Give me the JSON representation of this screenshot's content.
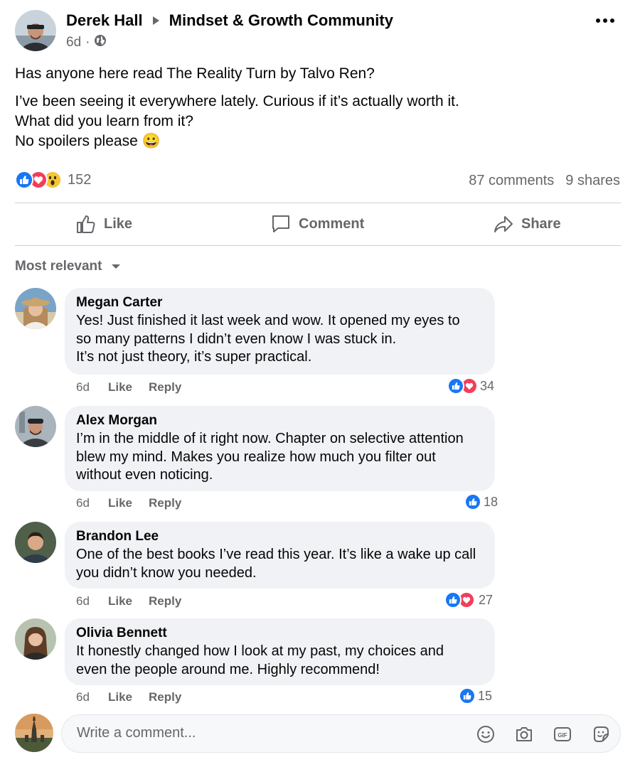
{
  "post": {
    "author": "Derek Hall",
    "group": "Mindset & Growth Community",
    "time": "6d",
    "separator": "·",
    "privacy_icon": "globe-icon",
    "menu_icon": "more-options-icon",
    "text_first": "Has anyone here read The Reality Turn by Talvo Ren?",
    "text_lines": [
      "I’ve been seeing it everywhere lately. Curious if it’s actually worth it.",
      "What did you learn from it?",
      "No spoilers please 😀"
    ],
    "reaction_icons": [
      "like-icon",
      "love-icon",
      "wow-icon"
    ],
    "reaction_count": "152",
    "comments_count": "87 comments",
    "shares_count": "9 shares"
  },
  "actions": {
    "like": "Like",
    "comment": "Comment",
    "share": "Share"
  },
  "sort_label": "Most relevant",
  "comments": [
    {
      "name": "Megan Carter",
      "lines": [
        "Yes! Just finished it last week and wow. It opened my eyes to",
        "so many patterns I didn’t even know I was stuck in.",
        "It’s not just theory, it’s super practical."
      ],
      "time": "6d",
      "like": "Like",
      "reply": "Reply",
      "reactions": [
        "like-icon",
        "love-icon"
      ],
      "count": "34"
    },
    {
      "name": "Alex Morgan",
      "lines": [
        "I’m in the middle of it right now. Chapter on selective attention",
        "blew my mind. Makes you realize how much you filter out",
        "without even noticing."
      ],
      "time": "6d",
      "like": "Like",
      "reply": "Reply",
      "reactions": [
        "like-icon"
      ],
      "count": "18"
    },
    {
      "name": "Brandon Lee",
      "lines": [
        "One of the best books I’ve read this year. It’s like a wake up call",
        "you didn’t know you needed."
      ],
      "time": "6d",
      "like": "Like",
      "reply": "Reply",
      "reactions": [
        "like-icon",
        "love-icon"
      ],
      "count": "27"
    },
    {
      "name": "Olivia Bennett",
      "lines": [
        "It honestly changed how I look at my past, my choices and",
        "even the people around me. Highly recommend!"
      ],
      "time": "6d",
      "like": "Like",
      "reply": "Reply",
      "reactions": [
        "like-icon"
      ],
      "count": "15"
    }
  ],
  "composer": {
    "placeholder": "Write a comment...",
    "tools": [
      "emoji-icon",
      "camera-icon",
      "gif-icon",
      "sticker-icon"
    ]
  },
  "colors": {
    "like_blue": "#1877f2",
    "love_red": "#f33e58",
    "wow_yellow": "#f7b928",
    "muted": "#65676b",
    "bubble_bg": "#f0f2f5"
  }
}
